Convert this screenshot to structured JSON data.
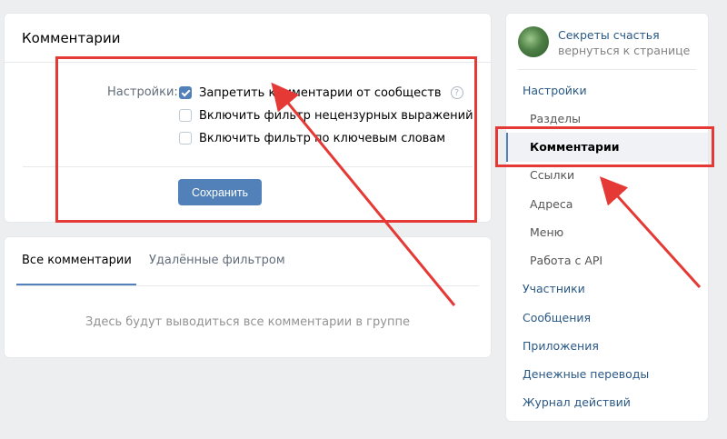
{
  "settings_card": {
    "title": "Комментарии",
    "settings_label": "Настройки:",
    "options": [
      {
        "label": "Запретить комментарии от сообществ",
        "checked": true,
        "help": "?"
      },
      {
        "label": "Включить фильтр нецензурных выражений",
        "checked": false
      },
      {
        "label": "Включить фильтр по ключевым словам",
        "checked": false
      }
    ],
    "save_label": "Сохранить"
  },
  "comments_card": {
    "tabs": [
      {
        "label": "Все комментарии",
        "active": true
      },
      {
        "label": "Удалённые фильтром",
        "active": false
      }
    ],
    "empty_text": "Здесь будут выводиться все комментарии в группе"
  },
  "menu": {
    "group_name": "Секреты счастья",
    "back_link": "вернуться к странице",
    "items": [
      {
        "label": "Настройки",
        "level": "top"
      },
      {
        "label": "Разделы",
        "level": "sub"
      },
      {
        "label": "Комментарии",
        "level": "sub",
        "active": true
      },
      {
        "label": "Ссылки",
        "level": "sub"
      },
      {
        "label": "Адреса",
        "level": "sub"
      },
      {
        "label": "Меню",
        "level": "sub"
      },
      {
        "label": "Работа с API",
        "level": "sub"
      },
      {
        "label": "Участники",
        "level": "top"
      },
      {
        "label": "Сообщения",
        "level": "top"
      },
      {
        "label": "Приложения",
        "level": "top"
      },
      {
        "label": "Денежные переводы",
        "level": "top"
      },
      {
        "label": "Журнал действий",
        "level": "top"
      }
    ]
  },
  "colors": {
    "accent": "#5181b8",
    "link": "#2a5885",
    "annotation_red": "#e53935"
  }
}
